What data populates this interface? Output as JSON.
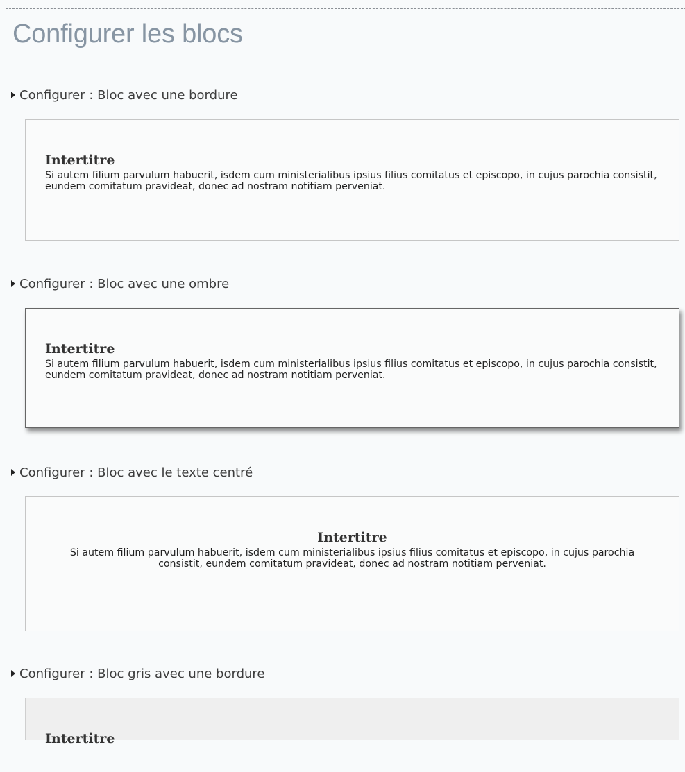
{
  "page": {
    "title": "Configurer les blocs"
  },
  "sections": [
    {
      "toggle_label": "Configurer : Bloc avec une bordure",
      "heading": "Intertitre",
      "text": "Si autem filium parvulum habuerit, isdem cum ministerialibus ipsius filius comitatus et episcopo, in cujus parochia consistit, eundem comitatum pravideat, donec ad nostram notitiam perveniat."
    },
    {
      "toggle_label": "Configurer : Bloc avec une ombre",
      "heading": "Intertitre",
      "text": "Si autem filium parvulum habuerit, isdem cum ministerialibus ipsius filius comitatus et episcopo, in cujus parochia consistit, eundem comitatum pravideat, donec ad nostram notitiam perveniat."
    },
    {
      "toggle_label": "Configurer : Bloc avec le texte centré",
      "heading": "Intertitre",
      "text": "Si autem filium parvulum habuerit, isdem cum ministerialibus ipsius filius comitatus et episcopo, in cujus parochia consistit, eundem comitatum pravideat, donec ad nostram notitiam perveniat."
    },
    {
      "toggle_label": "Configurer : Bloc gris avec une bordure",
      "heading": "Intertitre"
    }
  ],
  "colors": {
    "title": "#8795a3",
    "grey_block_background": "#efefef"
  }
}
